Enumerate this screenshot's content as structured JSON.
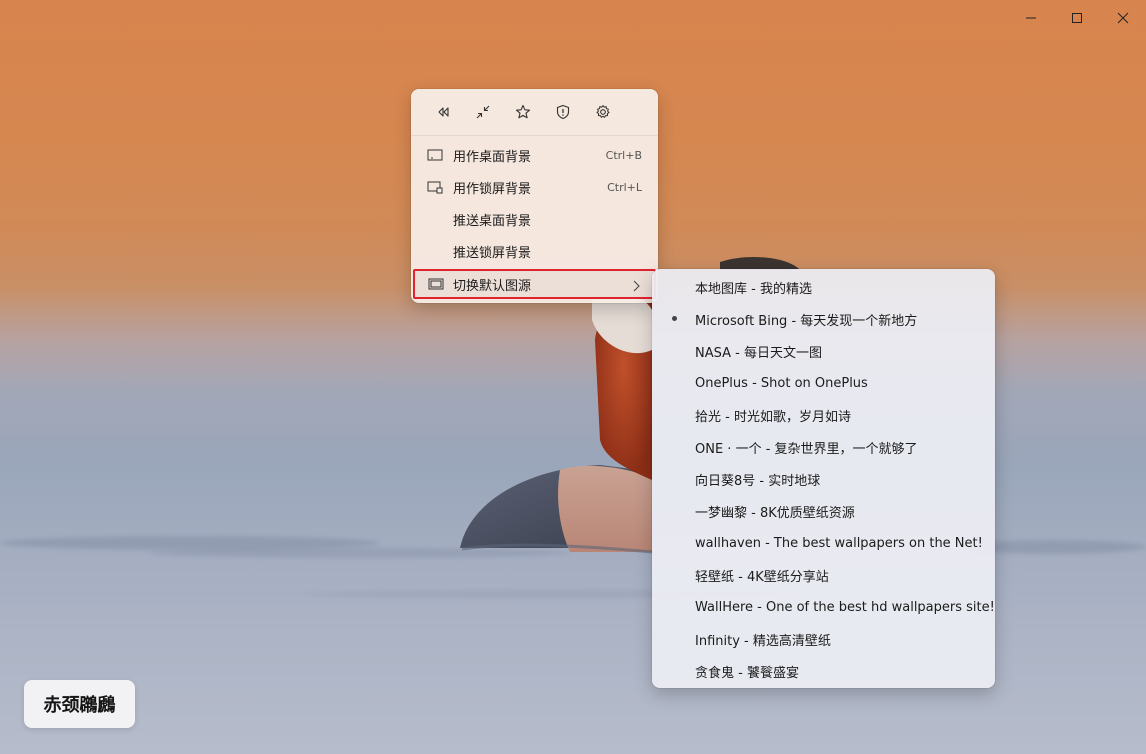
{
  "window": {
    "controls": [
      {
        "icon": "minimize-icon"
      },
      {
        "icon": "maximize-icon"
      },
      {
        "icon": "close-icon"
      }
    ]
  },
  "toolbar": [
    {
      "icon": "rewind-icon"
    },
    {
      "icon": "collapse-icon"
    },
    {
      "icon": "star-icon"
    },
    {
      "icon": "shield-icon"
    },
    {
      "icon": "gear-icon"
    }
  ],
  "menu": {
    "items": [
      {
        "label": "用作桌面背景",
        "shortcut": "Ctrl+B",
        "icon": "desktop-icon"
      },
      {
        "label": "用作锁屏背景",
        "shortcut": "Ctrl+L",
        "icon": "lockscreen-icon"
      },
      {
        "label": "推送桌面背景",
        "shortcut": ""
      },
      {
        "label": "推送锁屏背景",
        "shortcut": ""
      },
      {
        "label": "切换默认图源",
        "shortcut": "",
        "icon": "gallery-icon",
        "has_submenu": true
      }
    ]
  },
  "submenu": {
    "selected_index": 1,
    "items": [
      "本地图库 - 我的精选",
      "Microsoft Bing - 每天发现一个新地方",
      "NASA - 每日天文一图",
      "OnePlus - Shot on OnePlus",
      "拾光 - 时光如歌，岁月如诗",
      "ONE · 一个 - 复杂世界里，一个就够了",
      "向日葵8号 - 实时地球",
      "一梦幽黎 - 8K优质壁纸资源",
      "wallhaven - The best wallpapers on the Net!",
      "轻壁纸 - 4K壁纸分享站",
      "WallHere - One of the best hd wallpapers site!",
      "Infinity - 精选高清壁纸",
      "贪食鬼 - 饕餮盛宴"
    ]
  },
  "caption": {
    "text": "赤颈鸊鷉"
  },
  "colors": {
    "highlight_border": "#e0242e",
    "menu_bg": "#f7eee8",
    "submenu_bg": "#ecedf3"
  }
}
